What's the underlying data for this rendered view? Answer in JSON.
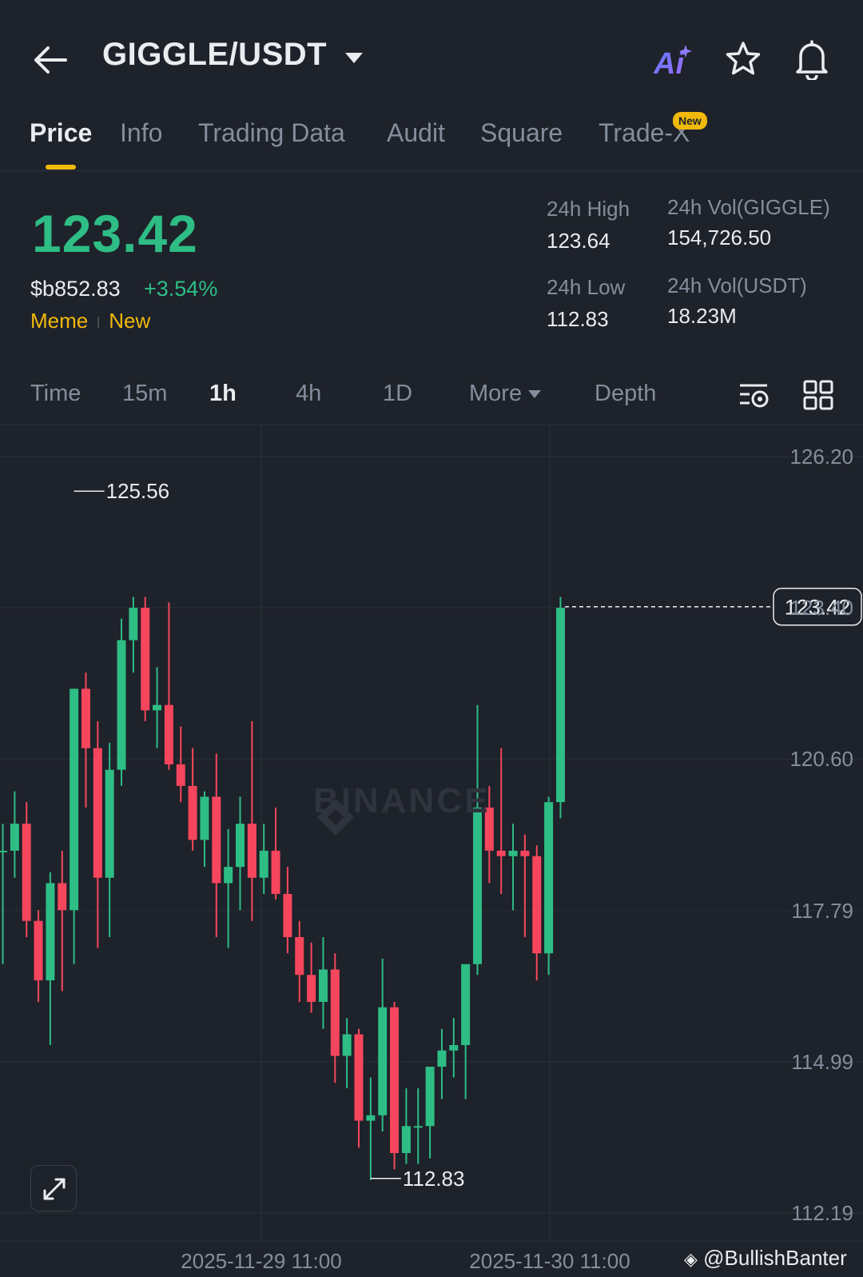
{
  "header": {
    "pair": "GIGGLE/USDT",
    "ai_label": "Ai"
  },
  "tabs": [
    {
      "label": "Price",
      "active": true
    },
    {
      "label": "Info",
      "active": false
    },
    {
      "label": "Trading Data",
      "active": false
    },
    {
      "label": "Audit",
      "active": false
    },
    {
      "label": "Square",
      "active": false
    },
    {
      "label": "Trade-X",
      "active": false,
      "badge": "New"
    }
  ],
  "ticker": {
    "last_price": "123.42",
    "usd_price": "$b852.83",
    "change": "+3.54%",
    "tags": [
      "Meme",
      "New"
    ],
    "stats": [
      {
        "label": "24h High",
        "value": "123.64"
      },
      {
        "label": "24h Vol(GIGGLE)",
        "value": "154,726.50"
      },
      {
        "label": "24h Low",
        "value": "112.83"
      },
      {
        "label": "24h Vol(USDT)",
        "value": "18.23M"
      }
    ]
  },
  "intervals": {
    "items": [
      "Time",
      "15m",
      "1h",
      "4h",
      "1D",
      "More",
      "Depth"
    ],
    "active": "1h"
  },
  "colors": {
    "up": "#2ebd85",
    "down": "#f6465d",
    "accent": "#f0b90b",
    "background": "#1e222a"
  },
  "icons": [
    "back-arrow-icon",
    "ai-icon",
    "star-icon",
    "bell-icon",
    "chart-settings-icon",
    "grid-layout-icon",
    "expand-icon",
    "binance-logo-icon"
  ],
  "chart_data": {
    "type": "candlestick",
    "y_ticks": [
      "126.20",
      "123.40",
      "120.60",
      "117.79",
      "114.99",
      "112.19"
    ],
    "ylim": [
      112.19,
      126.2
    ],
    "x_ticks": [
      "2025-11-29 11:00",
      "2025-11-30 11:00"
    ],
    "high_marker": "125.56",
    "low_marker": "112.83",
    "last_price_label": "123.42",
    "watermark": "BINANCE",
    "credit": "@BullishBanter",
    "candles": [
      {
        "o": 118.9,
        "h": 119.4,
        "l": 116.8,
        "c": 118.9
      },
      {
        "o": 118.9,
        "h": 120.0,
        "l": 118.4,
        "c": 119.4
      },
      {
        "o": 119.4,
        "h": 119.8,
        "l": 117.3,
        "c": 117.6
      },
      {
        "o": 117.6,
        "h": 117.8,
        "l": 116.1,
        "c": 116.5
      },
      {
        "o": 116.5,
        "h": 118.5,
        "l": 115.3,
        "c": 118.3
      },
      {
        "o": 118.3,
        "h": 118.9,
        "l": 116.3,
        "c": 117.8
      },
      {
        "o": 117.8,
        "h": 121.5,
        "l": 116.8,
        "c": 121.9
      },
      {
        "o": 121.9,
        "h": 122.2,
        "l": 119.7,
        "c": 120.8
      },
      {
        "o": 120.8,
        "h": 121.3,
        "l": 117.1,
        "c": 118.4
      },
      {
        "o": 118.4,
        "h": 120.9,
        "l": 117.3,
        "c": 120.4
      },
      {
        "o": 120.4,
        "h": 123.2,
        "l": 120.1,
        "c": 122.8
      },
      {
        "o": 122.8,
        "h": 123.6,
        "l": 122.2,
        "c": 123.4
      },
      {
        "o": 123.4,
        "h": 123.6,
        "l": 121.3,
        "c": 121.5
      },
      {
        "o": 121.5,
        "h": 122.3,
        "l": 120.8,
        "c": 121.6
      },
      {
        "o": 121.6,
        "h": 123.5,
        "l": 120.4,
        "c": 120.5
      },
      {
        "o": 120.5,
        "h": 121.2,
        "l": 119.8,
        "c": 120.1
      },
      {
        "o": 120.1,
        "h": 120.8,
        "l": 118.9,
        "c": 119.1
      },
      {
        "o": 119.1,
        "h": 120.0,
        "l": 118.6,
        "c": 119.9
      },
      {
        "o": 119.9,
        "h": 120.7,
        "l": 117.3,
        "c": 118.3
      },
      {
        "o": 118.3,
        "h": 119.3,
        "l": 117.1,
        "c": 118.6
      },
      {
        "o": 118.6,
        "h": 119.9,
        "l": 117.8,
        "c": 119.4
      },
      {
        "o": 119.4,
        "h": 121.3,
        "l": 117.6,
        "c": 118.4
      },
      {
        "o": 118.4,
        "h": 119.4,
        "l": 118.1,
        "c": 118.9
      },
      {
        "o": 118.9,
        "h": 119.7,
        "l": 118.0,
        "c": 118.1
      },
      {
        "o": 118.1,
        "h": 118.6,
        "l": 117.0,
        "c": 117.3
      },
      {
        "o": 117.3,
        "h": 117.6,
        "l": 116.1,
        "c": 116.6
      },
      {
        "o": 116.6,
        "h": 117.2,
        "l": 115.9,
        "c": 116.1
      },
      {
        "o": 116.1,
        "h": 117.3,
        "l": 115.6,
        "c": 116.7
      },
      {
        "o": 116.7,
        "h": 117.0,
        "l": 114.6,
        "c": 115.1
      },
      {
        "o": 115.1,
        "h": 115.8,
        "l": 114.5,
        "c": 115.5
      },
      {
        "o": 115.5,
        "h": 115.6,
        "l": 113.4,
        "c": 113.9
      },
      {
        "o": 113.9,
        "h": 114.7,
        "l": 112.8,
        "c": 114.0
      },
      {
        "o": 114.0,
        "h": 116.9,
        "l": 113.7,
        "c": 116.0
      },
      {
        "o": 116.0,
        "h": 116.1,
        "l": 113.0,
        "c": 113.3
      },
      {
        "o": 113.3,
        "h": 114.5,
        "l": 113.1,
        "c": 113.8
      },
      {
        "o": 113.8,
        "h": 114.5,
        "l": 113.1,
        "c": 113.8
      },
      {
        "o": 113.8,
        "h": 114.6,
        "l": 113.2,
        "c": 114.9
      },
      {
        "o": 114.9,
        "h": 115.6,
        "l": 114.3,
        "c": 115.2
      },
      {
        "o": 115.2,
        "h": 115.8,
        "l": 114.7,
        "c": 115.3
      },
      {
        "o": 115.3,
        "h": 115.5,
        "l": 114.3,
        "c": 116.8
      },
      {
        "o": 116.8,
        "h": 121.6,
        "l": 116.6,
        "c": 119.7
      },
      {
        "o": 119.7,
        "h": 120.1,
        "l": 118.3,
        "c": 118.9
      },
      {
        "o": 118.9,
        "h": 120.8,
        "l": 118.1,
        "c": 118.8
      },
      {
        "o": 118.8,
        "h": 119.4,
        "l": 117.8,
        "c": 118.9
      },
      {
        "o": 118.9,
        "h": 119.2,
        "l": 117.3,
        "c": 118.8
      },
      {
        "o": 118.8,
        "h": 119.0,
        "l": 116.5,
        "c": 117.0
      },
      {
        "o": 117.0,
        "h": 119.9,
        "l": 116.6,
        "c": 119.8
      },
      {
        "o": 119.8,
        "h": 123.6,
        "l": 119.5,
        "c": 123.4
      }
    ]
  }
}
